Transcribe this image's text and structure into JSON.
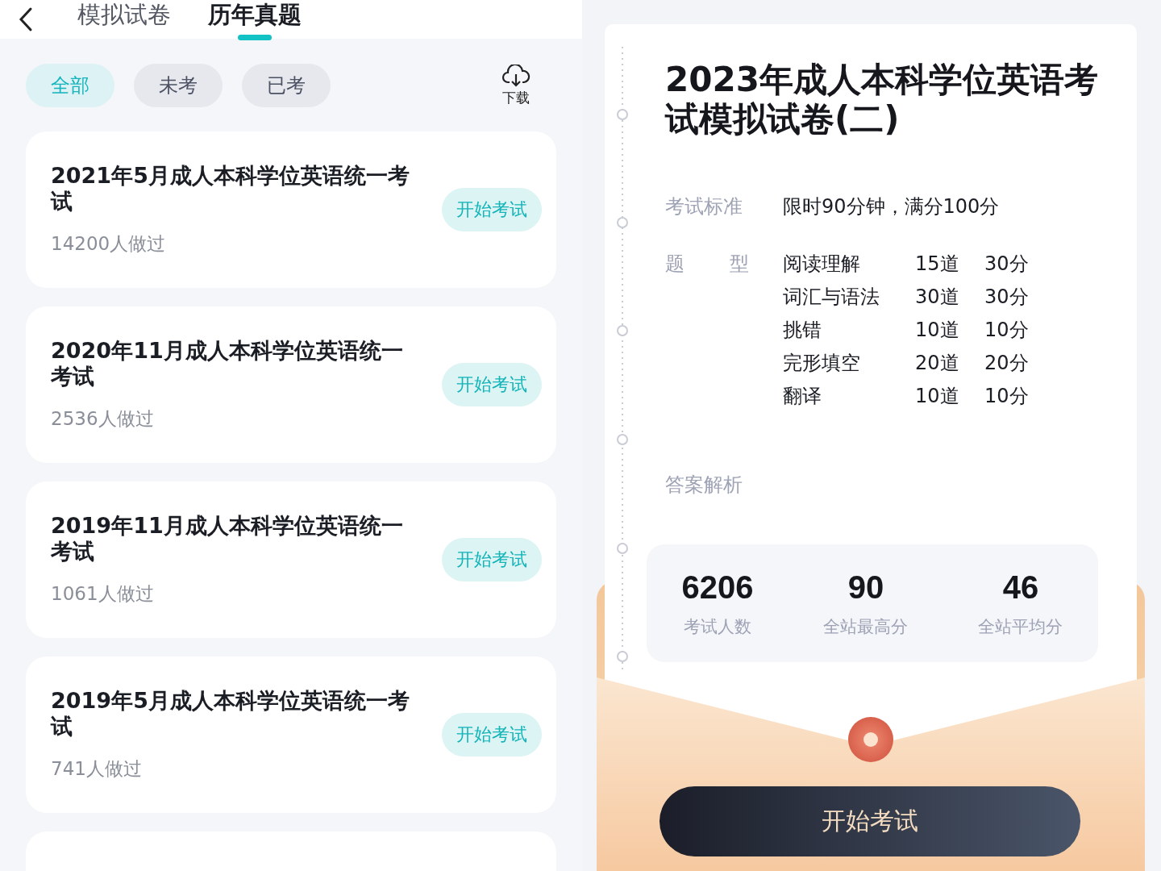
{
  "header": {
    "tabs": [
      {
        "label": "模拟试卷",
        "selected": false
      },
      {
        "label": "历年真题",
        "selected": true
      }
    ]
  },
  "filters": [
    {
      "label": "全部",
      "selected": true
    },
    {
      "label": "未考",
      "selected": false
    },
    {
      "label": "已考",
      "selected": false
    }
  ],
  "download": {
    "label": "下载"
  },
  "papers": [
    {
      "title": "2021年5月成人本科学位英语统一考试",
      "count": "14200人做过",
      "action": "开始考试"
    },
    {
      "title": "2020年11月成人本科学位英语统一考试",
      "count": "2536人做过",
      "action": "开始考试"
    },
    {
      "title": "2019年11月成人本科学位英语统一考试",
      "count": "1061人做过",
      "action": "开始考试"
    },
    {
      "title": "2019年5月成人本科学位英语统一考试",
      "count": "741人做过",
      "action": "开始考试"
    }
  ],
  "detail": {
    "title": "2023年成人本科学位英语考试模拟试卷(二)",
    "standard_label": "考试标准",
    "standard": "限时90分钟，满分100分",
    "types_label": [
      "题",
      "型"
    ],
    "types": [
      {
        "name": "阅读理解",
        "count": "15道",
        "score": "30分"
      },
      {
        "name": "词汇与语法",
        "count": "30道",
        "score": "30分"
      },
      {
        "name": "挑错",
        "count": "10道",
        "score": "10分"
      },
      {
        "name": "完形填空",
        "count": "20道",
        "score": "20分"
      },
      {
        "name": "翻译",
        "count": "10道",
        "score": "10分"
      }
    ],
    "analysis_label": "答案解析",
    "stats": [
      {
        "value": "6206",
        "label": "考试人数"
      },
      {
        "value": "90",
        "label": "全站最高分"
      },
      {
        "value": "46",
        "label": "全站平均分"
      }
    ],
    "start_button": "开始考试"
  }
}
